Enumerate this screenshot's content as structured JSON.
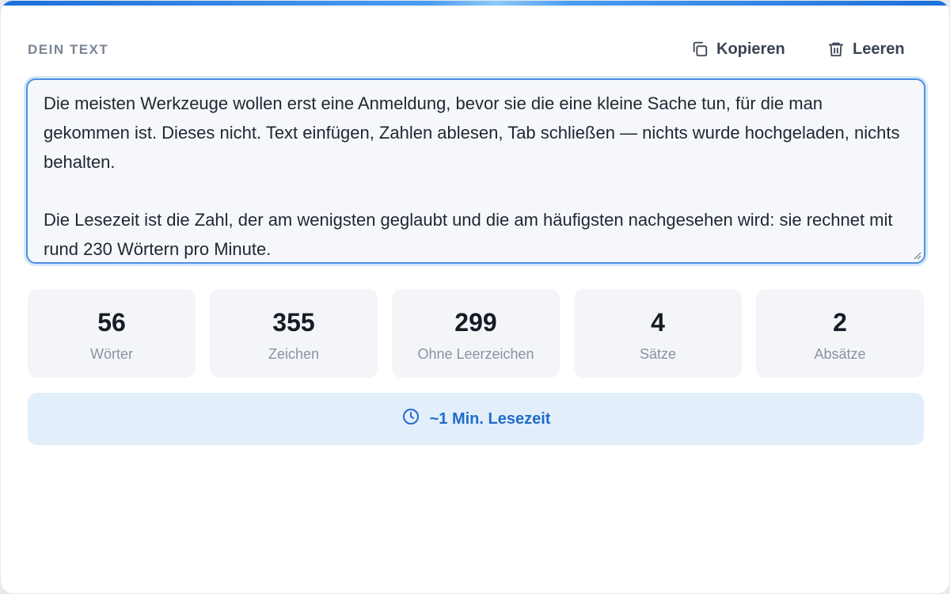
{
  "header": {
    "label": "DEIN TEXT",
    "copy_label": "Kopieren",
    "clear_label": "Leeren"
  },
  "editor": {
    "value": "Die meisten Werkzeuge wollen erst eine Anmeldung, bevor sie die eine kleine Sache tun, für die man gekommen ist. Dieses nicht. Text einfügen, Zahlen ablesen, Tab schließen — nichts wurde hochgeladen, nichts behalten.\n\nDie Lesezeit ist die Zahl, der am wenigsten geglaubt und die am häufigsten nachgesehen wird: sie rechnet mit rund 230 Wörtern pro Minute."
  },
  "stats": [
    {
      "value": "56",
      "label": "Wörter"
    },
    {
      "value": "355",
      "label": "Zeichen"
    },
    {
      "value": "299",
      "label": "Ohne Leerzeichen"
    },
    {
      "value": "4",
      "label": "Sätze"
    },
    {
      "value": "2",
      "label": "Absätze"
    }
  ],
  "reading_time": {
    "label": "~1 Min. Lesezeit"
  },
  "colors": {
    "accent": "#1f6cc9",
    "focus_border": "#4d90e0",
    "stat_bg": "#f3f5f8",
    "reading_bg": "#e3eefb"
  },
  "icons": {
    "copy": "copy-icon",
    "clear": "trash-icon",
    "reading": "clock-icon"
  }
}
